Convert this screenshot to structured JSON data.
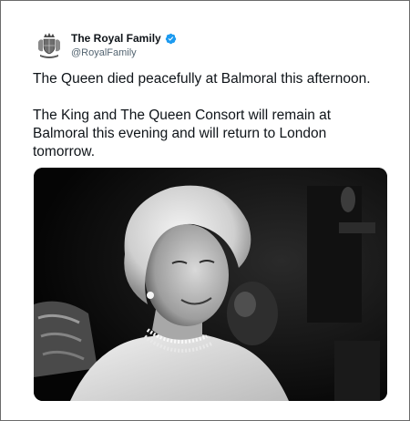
{
  "tweet": {
    "author_name": "The Royal Family",
    "author_handle": "@RoyalFamily",
    "verified": true,
    "text_line1": "The Queen died peacefully at Balmoral this afternoon.",
    "text_line2": "The King and The Queen Consort will remain at Balmoral this evening and will return to London tomorrow.",
    "accent_color": "#1d9bf0",
    "media": {
      "type": "photo",
      "style": "black-and-white"
    }
  },
  "icons": {
    "avatar": "royal-crest-icon",
    "verified": "verified-badge-icon"
  }
}
